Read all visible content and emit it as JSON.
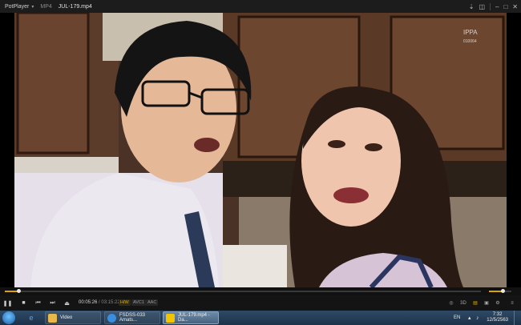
{
  "titlebar": {
    "app_name": "PotPlayer",
    "format": "MP4",
    "filename": "JUL-179.mp4",
    "icons": [
      "pin-icon",
      "stereo-icon",
      "minimize-icon",
      "maximize-icon",
      "close-icon"
    ]
  },
  "video": {
    "watermark_text": "IPPA",
    "watermark_code": "010064"
  },
  "playback": {
    "current_time": "00:05:26",
    "separator": " / ",
    "duration": "03:15:22",
    "progress_fraction": 0.028,
    "volume_fraction": 0.6,
    "tags": [
      "H/W",
      "AVC1",
      "AAC"
    ]
  },
  "taskbar": {
    "tasks": [
      {
        "label": "Video",
        "color": "#e8b84a"
      },
      {
        "label": "FSDSS-033 Amats...",
        "color": "#3a8ee0"
      },
      {
        "label": "JUL-179.mp4 - Da...",
        "color": "#f2c500"
      }
    ],
    "language": "EN",
    "time": "7:32",
    "date": "12/5/2563"
  }
}
